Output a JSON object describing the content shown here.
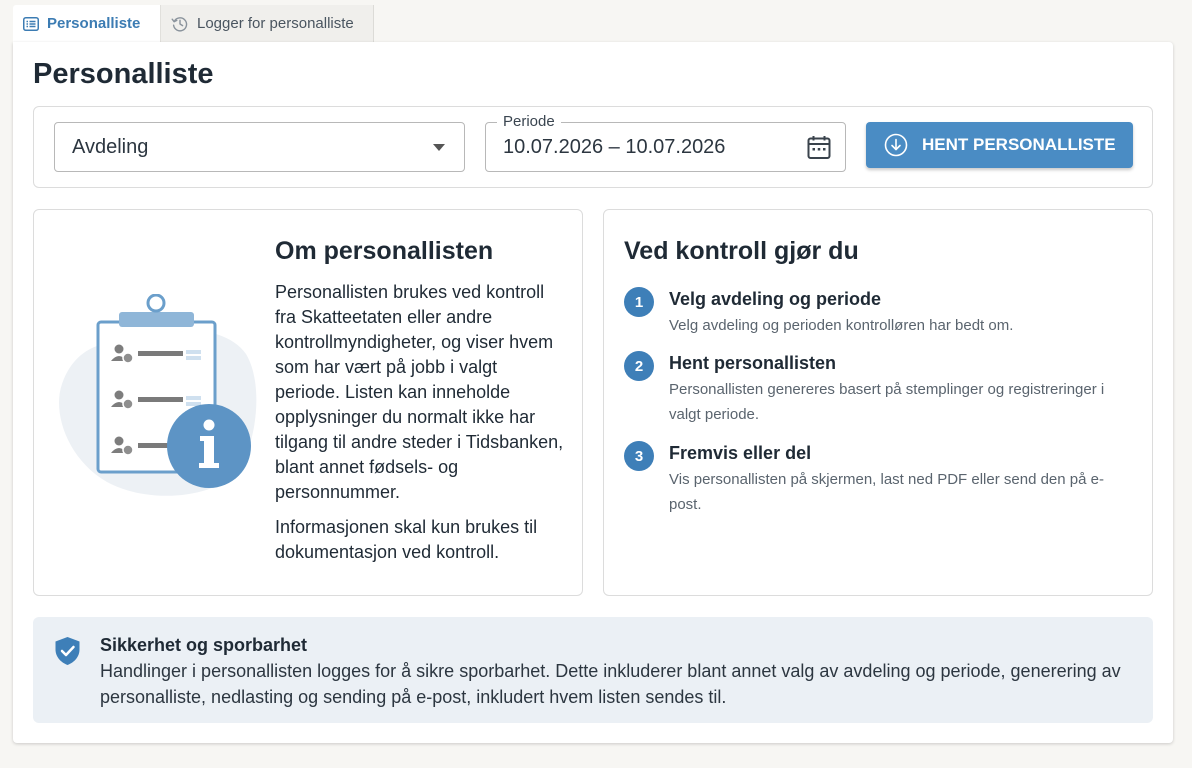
{
  "tabs": [
    {
      "label": "Personalliste",
      "icon": "list-icon",
      "active": true
    },
    {
      "label": "Logger for personalliste",
      "icon": "history-icon",
      "active": false
    }
  ],
  "page": {
    "title": "Personalliste"
  },
  "filters": {
    "department_value": "Avdeling",
    "period_label": "Periode",
    "period_value": "10.07.2026 – 10.07.2026",
    "fetch_button_label": "HENT PERSONALLISTE"
  },
  "about": {
    "title": "Om personallisten",
    "paragraph1": "Personallisten brukes ved kontroll fra Skatteetaten eller andre kontrollmyndigheter, og viser hvem som har vært på jobb i valgt periode. Listen kan inneholde opplysninger du normalt ikke har tilgang til andre steder i Tidsbanken, blant annet fødsels- og personnummer.",
    "paragraph2": "Informasjonen skal kun brukes til dokumentasjon ved kontroll."
  },
  "control": {
    "title": "Ved kontroll gjør du",
    "steps": [
      {
        "number": "1",
        "title": "Velg avdeling og periode",
        "description": "Velg avdeling og perioden kontrolløren har bedt om."
      },
      {
        "number": "2",
        "title": "Hent personallisten",
        "description": "Personallisten genereres basert på stemplinger og registreringer i valgt periode."
      },
      {
        "number": "3",
        "title": "Fremvis eller del",
        "description": "Vis personallisten på skjermen, last ned PDF eller send den på e-post."
      }
    ]
  },
  "security": {
    "title": "Sikkerhet og sporbarhet",
    "text": "Handlinger i personallisten logges for å sikre sporbarhet. Dette inkluderer blant annet valg av avdeling og periode, generering av personalliste, nedlasting og sending på e-post, inkludert hvem listen sendes til."
  },
  "colors": {
    "accent": "#4a8cc4",
    "step_badge": "#3e7fb8",
    "security_bg": "#ebf0f5",
    "background": "#f7f6f3"
  }
}
